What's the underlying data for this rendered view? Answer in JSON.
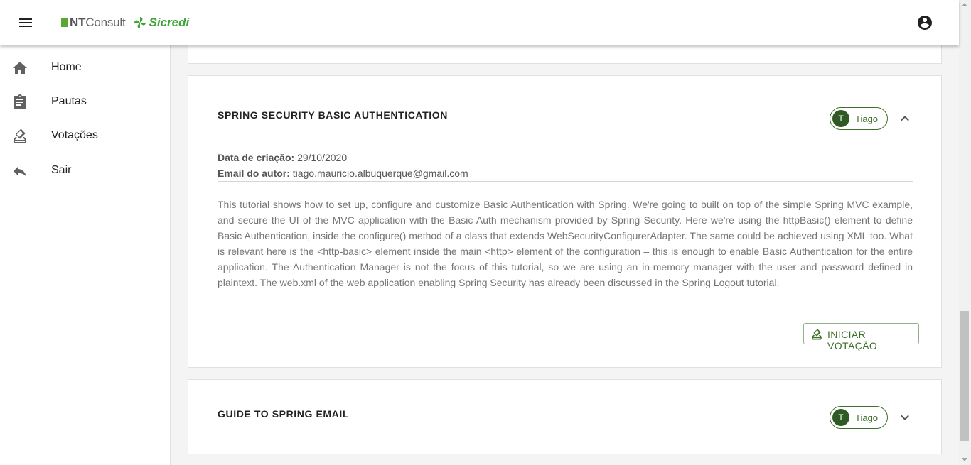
{
  "header": {
    "logo_nt_prefix": "NT",
    "logo_nt_suffix": "Consult",
    "logo_brand": "Sicredi",
    "menu_icon": "menu-icon",
    "account_icon": "account-circle-icon"
  },
  "sidebar": {
    "items": [
      {
        "label": "Home",
        "icon": "home-icon"
      },
      {
        "label": "Pautas",
        "icon": "clipboard-icon"
      },
      {
        "label": "Votações",
        "icon": "ballot-icon"
      },
      {
        "label": "Sair",
        "icon": "reply-icon"
      }
    ]
  },
  "cards": [
    {
      "title": "SPRING SECURITY BASIC AUTHENTICATION",
      "author_initial": "T",
      "author_name": "Tiago",
      "expanded": true,
      "created_label": "Data de criação:",
      "created_value": "29/10/2020",
      "email_label": "Email do autor:",
      "email_value": "tiago.mauricio.albuquerque@gmail.com",
      "description": "This tutorial shows how to set up, configure and customize Basic Authentication with Spring. We're going to built on top of the simple Spring MVC example, and secure the UI of the MVC application with the Basic Auth mechanism provided by Spring Security. Here we're using the httpBasic() element to define Basic Authentication, inside the configure() method of a class that extends WebSecurityConfigurerAdapter. The same could be achieved using XML too. What is relevant here is the <http-basic> element inside the main <http> element of the configuration – this is enough to enable Basic Authentication for the entire application. The Authentication Manager is not the focus of this tutorial, so we are using an in-memory manager with the user and password defined in plaintext. The web.xml of the web application enabling Spring Security has already been discussed in the Spring Logout tutorial.",
      "action_label": "INICIAR VOTAÇÃO"
    },
    {
      "title": "GUIDE TO SPRING EMAIL",
      "author_initial": "T",
      "author_name": "Tiago",
      "expanded": false
    }
  ],
  "colors": {
    "brand_green": "#3fa535",
    "chip_green": "#3e6f2a",
    "avatar_green": "#2f5a23"
  }
}
